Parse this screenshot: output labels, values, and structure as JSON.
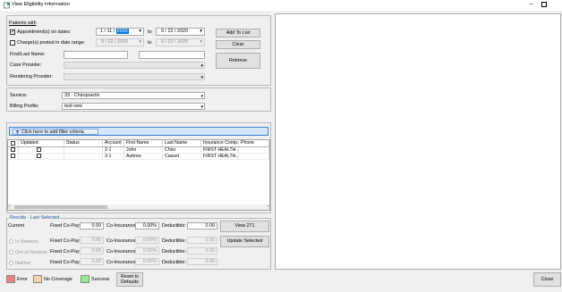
{
  "window": {
    "title": "View Eligibility Information",
    "minimize": "–"
  },
  "patients_with": {
    "heading": "Patients with",
    "appointments_label": "Appointment(s) on dates:",
    "appointments_checked": true,
    "appt_from": {
      "month": "1",
      "day": "11",
      "year": "2020"
    },
    "appt_to": "9 / 22 / 2020",
    "to_label": "to",
    "charges_label": "Charge(s) posted in date range:",
    "charges_checked": false,
    "charges_from": "9 / 22 / 2020",
    "charges_to": "9 / 22 / 2020",
    "name_label": "First/Last Name:",
    "first_name": "",
    "last_name": "",
    "case_provider_label": "Case Provider:",
    "rendering_provider_label": "Rendering Provider:",
    "add_to_list": "Add To List",
    "clear": "Clear",
    "retrieve": "Retrieve"
  },
  "service": {
    "service_label": "Service:",
    "service_value": "33 - Chiropractic",
    "billing_label": "Billing Profile:",
    "billing_value": "test new"
  },
  "grid": {
    "filter_label": "Click here to add filter criteria",
    "columns": [
      "",
      "Updated",
      "Status",
      "Account",
      "First Name",
      "Last Name",
      "Insurance Comp...",
      "Phone"
    ],
    "rows": [
      {
        "checked": false,
        "updated": false,
        "status": "",
        "account": "2-1",
        "first": "John",
        "last": "Chiro",
        "insurance": "FIRST HEALTH...",
        "phone": ""
      },
      {
        "checked": false,
        "updated": false,
        "status": "",
        "account": "3-1",
        "first": "Aubree",
        "last": "Cassel",
        "insurance": "FIRST HEALTH...",
        "phone": ""
      }
    ]
  },
  "results": {
    "legend": "Results - Last Selected",
    "current_label": "Current",
    "copay_label": "Fixed Co-Pay:",
    "coins_label": "Co-Insurance:",
    "deduct_label": "Deductible:",
    "current": {
      "copay": "0.00",
      "coins": "0.00%",
      "deduct": "0.00"
    },
    "in_network": {
      "label": "In Network",
      "copay": "0.00",
      "coins": "0.00%",
      "deduct": "0.00"
    },
    "out_network": {
      "label": "Out of Network",
      "copay": "0.00",
      "coins": "0.00%",
      "deduct": "0.00"
    },
    "neither": {
      "label": "Neither",
      "copay": "0.00",
      "coins": "0.00%",
      "deduct": "0.00"
    },
    "view_271": "View 271",
    "update_selected": "Update Selected"
  },
  "legend_bar": {
    "error": {
      "label": "Error",
      "color": "#f08080"
    },
    "no_coverage": {
      "label": "No Coverage",
      "color": "#f8d5a3"
    },
    "success": {
      "label": "Success",
      "color": "#90ee90"
    },
    "reset_line1": "Reset to",
    "reset_line2": "Defaults"
  },
  "close": "Close",
  "accent": "#0078d7"
}
